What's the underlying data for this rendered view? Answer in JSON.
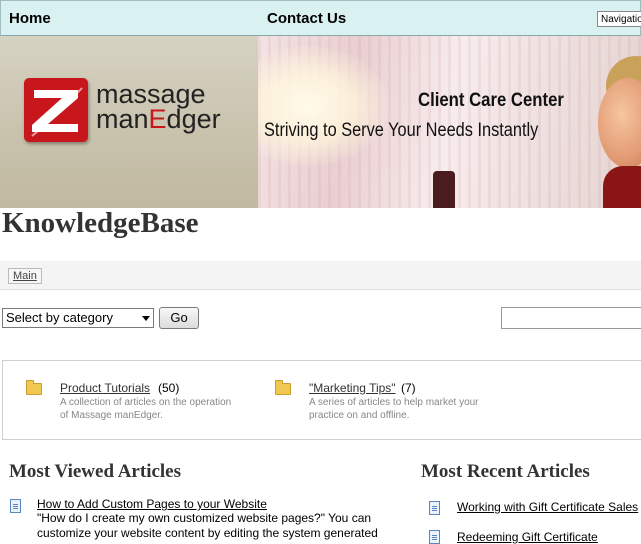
{
  "topnav": {
    "home": "Home",
    "contact": "Contact Us",
    "navigation_select": "Navigatio"
  },
  "banner": {
    "logo_line1": "massage",
    "logo_line2_a": "man",
    "logo_line2_e": "E",
    "logo_line2_b": "dger",
    "logo_letter": "Z",
    "title": "Client Care Center",
    "subtitle": "Striving to Serve Your Needs Instantly"
  },
  "page_title": "KnowledgeBase",
  "breadcrumb": {
    "main": "Main"
  },
  "filter": {
    "selected": "Select by category",
    "go": "Go"
  },
  "categories": [
    {
      "name": "Product Tutorials",
      "count": "(50)",
      "desc1": "A collection of articles on the operation",
      "desc2": "of Massage manEdger."
    },
    {
      "name": "\"Marketing Tips\"",
      "count": "(7)",
      "desc1": "A series of articles to help market your",
      "desc2": "practice on and offline."
    }
  ],
  "most_viewed": {
    "title": "Most Viewed Articles",
    "items": [
      {
        "link": "How to Add Custom Pages to your Website",
        "snippet1": "\"How do I create my own customized website pages?\" You can",
        "snippet2": "customize your website content by editing the system generated"
      }
    ]
  },
  "most_recent": {
    "title": "Most Recent Articles",
    "items": [
      {
        "link": "Working with Gift Certificate Sales"
      },
      {
        "link": "Redeeming Gift Certificate"
      }
    ]
  }
}
